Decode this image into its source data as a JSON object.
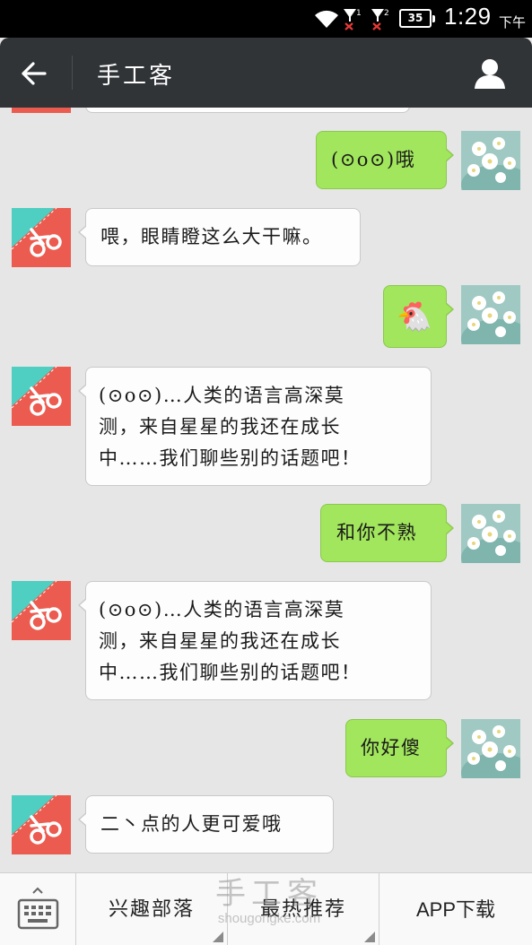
{
  "status_bar": {
    "battery": "35",
    "time": "1:29",
    "ampm": "下午",
    "signal1_label": "1",
    "signal2_label": "2"
  },
  "header": {
    "title": "手工客"
  },
  "chat": {
    "messages": [
      {
        "from": "me",
        "text": "(⊙o⊙)哦"
      },
      {
        "from": "bot",
        "text": "喂，眼睛瞪这么大干嘛。"
      },
      {
        "from": "me",
        "text": "🐔"
      },
      {
        "from": "bot",
        "lines": [
          "(⊙o⊙)…人类的语言高深莫",
          "测，来自星星的我还在成长",
          "中……我们聊些别的话题吧！"
        ]
      },
      {
        "from": "me",
        "text": "和你不熟"
      },
      {
        "from": "bot",
        "lines": [
          "(⊙o⊙)…人类的语言高深莫",
          "测，来自星星的我还在成长",
          "中……我们聊些别的话题吧！"
        ]
      },
      {
        "from": "me",
        "text": "你好傻"
      },
      {
        "from": "bot",
        "text": "二丶点的人更可爱哦"
      }
    ]
  },
  "bottom_bar": {
    "menu1": "兴趣部落",
    "menu2": "最热推荐",
    "menu3": "APP下载"
  },
  "watermark": {
    "main": "手工客",
    "sub": "shougongke.com"
  },
  "colors": {
    "header_bg": "#313437",
    "chat_bg": "#e6e6e6",
    "outgoing_bubble": "#a1e65c",
    "incoming_bubble": "#fdfdfd",
    "bot_avatar_red": "#ec5b4f",
    "bot_avatar_teal": "#4ecfc2"
  },
  "icons": {
    "back": "back-arrow-icon",
    "profile": "person-icon",
    "keyboard": "keyboard-icon",
    "wifi": "wifi-icon",
    "signal": "signal-icon"
  }
}
